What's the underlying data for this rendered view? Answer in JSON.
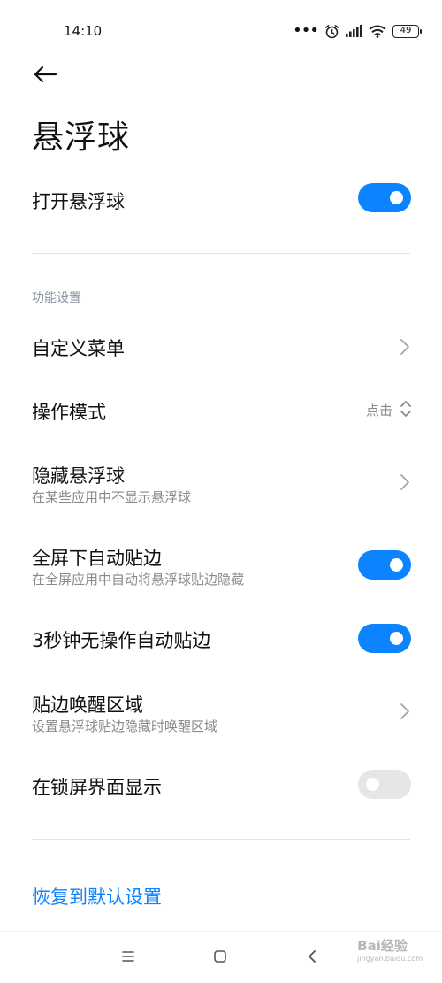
{
  "status_bar": {
    "time": "14:10",
    "battery": "49",
    "icons": [
      "more-dots-icon",
      "alarm-icon",
      "signal-icon",
      "wifi-icon",
      "battery-icon"
    ]
  },
  "header": {
    "title": "悬浮球"
  },
  "main_toggle": {
    "label": "打开悬浮球",
    "on": true
  },
  "section": {
    "label": "功能设置"
  },
  "settings": [
    {
      "title": "自定义菜单",
      "control": "chevron"
    },
    {
      "title": "操作模式",
      "control": "select",
      "value": "点击"
    },
    {
      "title": "隐藏悬浮球",
      "subtitle": "在某些应用中不显示悬浮球",
      "control": "chevron"
    },
    {
      "title": "全屏下自动贴边",
      "subtitle": "在全屏应用中自动将悬浮球贴边隐藏",
      "control": "toggle",
      "on": true
    },
    {
      "title": "3秒钟无操作自动贴边",
      "control": "toggle",
      "on": true
    },
    {
      "title": "贴边唤醒区域",
      "subtitle": "设置悬浮球贴边隐藏时唤醒区域",
      "control": "chevron"
    },
    {
      "title": "在锁屏界面显示",
      "control": "toggle",
      "on": false
    }
  ],
  "reset": {
    "label": "恢复到默认设置"
  },
  "watermark": {
    "text": "Bai经验",
    "sub": "jingyan.baidu.com"
  },
  "colors": {
    "accent": "#0d84ff",
    "toggle_off": "#e6e6e6",
    "secondary_text": "#8a8a8a"
  }
}
